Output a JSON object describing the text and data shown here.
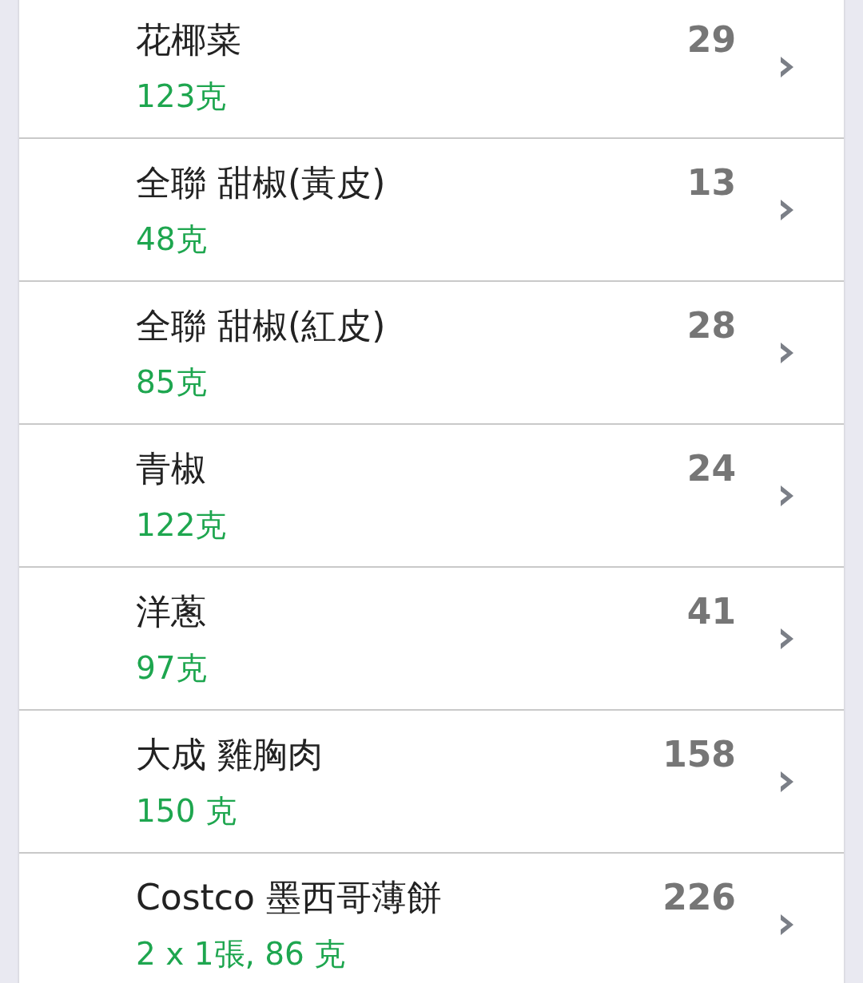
{
  "food_list": [
    {
      "name": "花椰菜",
      "amount": "123克",
      "calories": "29"
    },
    {
      "name": "全聯 甜椒(黃皮)",
      "amount": "48克",
      "calories": "13"
    },
    {
      "name": "全聯 甜椒(紅皮)",
      "amount": "85克",
      "calories": "28"
    },
    {
      "name": "青椒",
      "amount": "122克",
      "calories": "24"
    },
    {
      "name": "洋蔥",
      "amount": "97克",
      "calories": "41"
    },
    {
      "name": "大成 雞胸肉",
      "amount": "150 克",
      "calories": "158"
    },
    {
      "name": "Costco 墨西哥薄餅",
      "amount": "2 x 1張, 86 克",
      "calories": "226"
    }
  ]
}
